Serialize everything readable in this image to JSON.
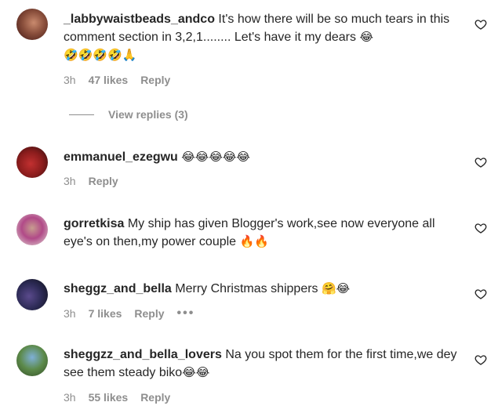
{
  "comments": [
    {
      "username": "_labbywaistbeads_andco",
      "text": "It's how there will be so much tears in this comment section in 3,2,1........ Let's have it my dears",
      "emojis_inline": "😂",
      "emojis_line2": "🤣🤣🤣🤣🙏",
      "time": "3h",
      "likes": "47 likes",
      "reply": "Reply"
    },
    {
      "username": "emmanuel_ezegwu",
      "text": "",
      "emojis_inline": "😂😂😂😂😂",
      "time": "3h",
      "reply": "Reply"
    },
    {
      "username": "gorretkisa",
      "text": "My ship has given Blogger's work,see now everyone all eye's on then,my power couple",
      "emojis_inline": "🔥🔥"
    },
    {
      "username": "sheggz_and_bella",
      "text": "Merry Christmas shippers",
      "emojis_inline": "🤗😂",
      "time": "3h",
      "likes": "7 likes",
      "reply": "Reply",
      "more": "•••"
    },
    {
      "username": "sheggzz_and_bella_lovers",
      "text": "Na you spot them for the first time,we dey see them steady biko",
      "emojis_inline": "😂😂",
      "time": "3h",
      "likes": "55 likes",
      "reply": "Reply"
    }
  ],
  "view_replies": "View replies (3)",
  "icons": {
    "like": "heart-outline-icon"
  },
  "colors": {
    "text": "#262626",
    "muted": "#8e8e8e"
  }
}
